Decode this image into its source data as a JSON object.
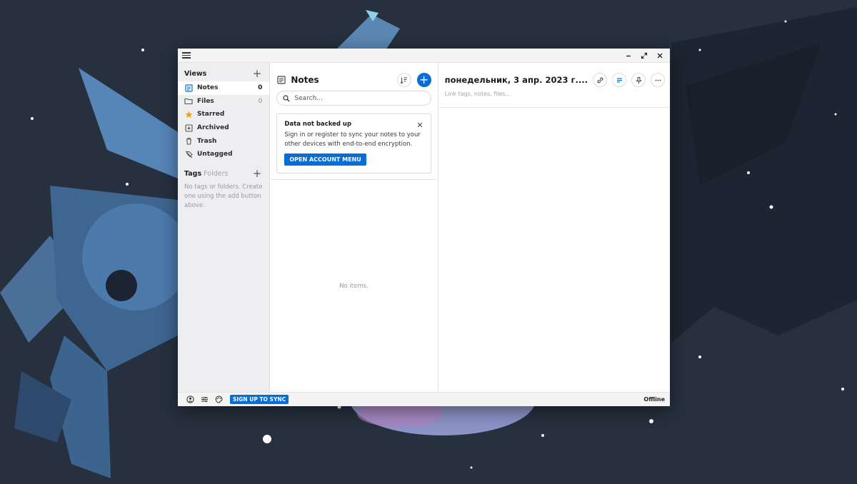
{
  "window": {
    "controls": {
      "minimize_icon": "minimize-icon",
      "maximize_icon": "maximize-icon",
      "close_icon": "close-icon"
    }
  },
  "sidebar": {
    "views_title": "Views",
    "items": [
      {
        "label": "Notes",
        "count": "0",
        "icon": "notes-icon",
        "active": true
      },
      {
        "label": "Files",
        "count": "0",
        "icon": "folder-icon"
      },
      {
        "label": "Starred",
        "count": "",
        "icon": "star-icon"
      },
      {
        "label": "Archived",
        "count": "",
        "icon": "archive-icon"
      },
      {
        "label": "Trash",
        "count": "",
        "icon": "trash-icon"
      },
      {
        "label": "Untagged",
        "count": "",
        "icon": "untagged-icon"
      }
    ],
    "tags_title": "Tags",
    "folders_label": "Folders",
    "tags_empty": "No tags or folders. Create one using the add button above."
  },
  "notes_list": {
    "title": "Notes",
    "search_placeholder": "Search...",
    "banner": {
      "title": "Data not backed up",
      "body": "Sign in or register to sync your notes to your other devices with end-to-end encryption.",
      "button": "OPEN ACCOUNT MENU"
    },
    "empty_text": "No items."
  },
  "editor": {
    "title": "понедельник, 3 апр. 2023 г....",
    "links_placeholder": "Link tags, notes, files..."
  },
  "footer": {
    "sync_button": "SIGN UP TO SYNC",
    "status": "Offline"
  },
  "colors": {
    "accent": "#086dd6",
    "wallpaper": "#26303e",
    "star": "#f3a20f"
  }
}
